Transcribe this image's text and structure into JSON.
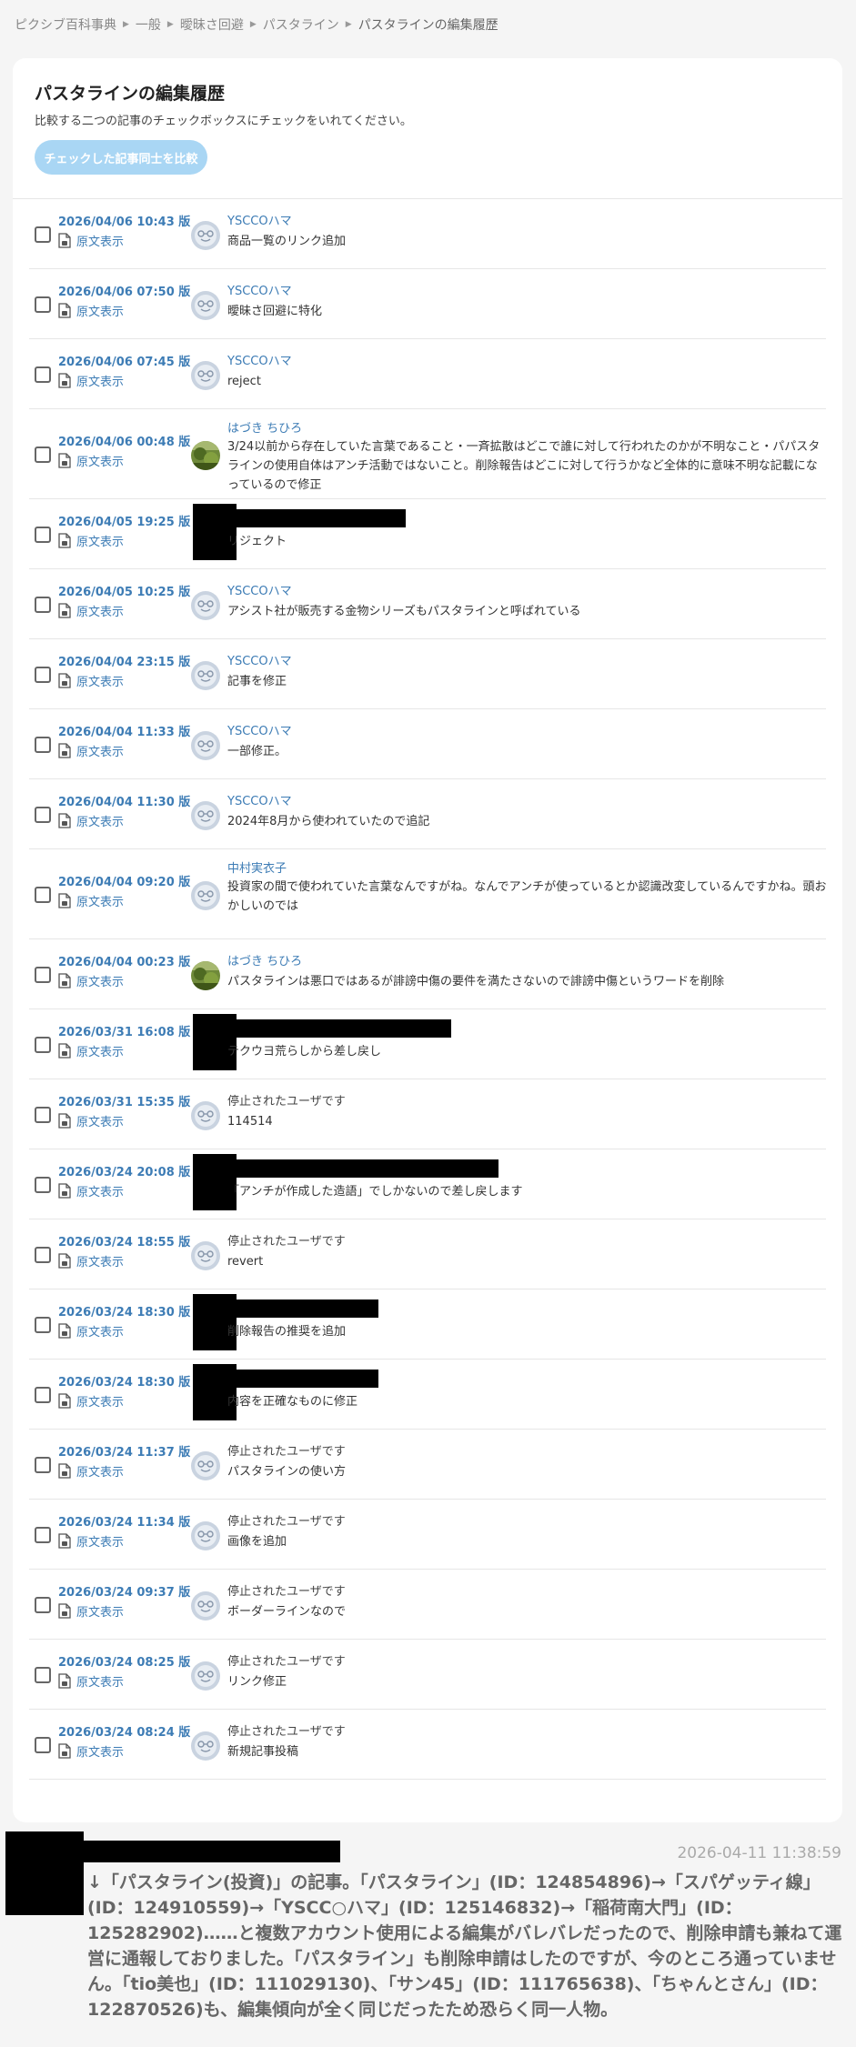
{
  "breadcrumb": {
    "items": [
      "ピクシブ百科事典",
      "一般",
      "曖昧さ回避",
      "パスタライン"
    ],
    "current": "パスタラインの編集履歴"
  },
  "page": {
    "title": "パスタラインの編集履歴",
    "description": "比較する二つの記事のチェックボックスにチェックをいれてください。",
    "compare_button": "チェックした記事同士を比較",
    "source_link_label": "原文表示"
  },
  "colors": {
    "link": "#3d7cb5",
    "button_disabled": "#a9d6f4"
  },
  "revisions": [
    {
      "date": "2026/04/06 10:43 版",
      "user": "YSCCOハマ",
      "user_type": "link",
      "avatar": "default-avatar",
      "comment": "商品一覧のリンク追加"
    },
    {
      "date": "2026/04/06 07:50 版",
      "user": "YSCCOハマ",
      "user_type": "link",
      "avatar": "default-avatar",
      "comment": "曖昧さ回避に特化"
    },
    {
      "date": "2026/04/06 07:45 版",
      "user": "YSCCOハマ",
      "user_type": "link",
      "avatar": "default-avatar",
      "comment": "reject"
    },
    {
      "date": "2026/04/06 00:48 版",
      "user": "はづき ちひろ",
      "user_type": "link",
      "avatar": "photo-avatar",
      "comment": "3/24以前から存在していた言葉であること・一斉拡散はどこで誰に対して行われたのかが不明なこと・パパスタラインの使用自体はアンチ活動ではないこと。削除報告はどこに対して行うかなど全体的に意味不明な記載になっているので修正"
    },
    {
      "date": "2026/04/05 19:25 版",
      "user": "",
      "user_type": "redacted",
      "avatar": "redacted",
      "comment": "リジェクト"
    },
    {
      "date": "2026/04/05 10:25 版",
      "user": "YSCCOハマ",
      "user_type": "link",
      "avatar": "default-avatar",
      "comment": "アシスト社が販売する金物シリーズもパスタラインと呼ばれている"
    },
    {
      "date": "2026/04/04 23:15 版",
      "user": "YSCCOハマ",
      "user_type": "link",
      "avatar": "default-avatar",
      "comment": "記事を修正"
    },
    {
      "date": "2026/04/04 11:33 版",
      "user": "YSCCOハマ",
      "user_type": "link",
      "avatar": "default-avatar",
      "comment": "一部修正。"
    },
    {
      "date": "2026/04/04 11:30 版",
      "user": "YSCCOハマ",
      "user_type": "link",
      "avatar": "default-avatar",
      "comment": "2024年8月から使われていたので追記"
    },
    {
      "date": "2026/04/04 09:20 版",
      "user": "中村実衣子",
      "user_type": "link",
      "avatar": "default-avatar",
      "comment": "投資家の間で使われていた言葉なんですがね。なんでアンチが使っているとか認識改変しているんですかね。頭おかしいのでは"
    },
    {
      "date": "2026/04/04 00:23 版",
      "user": "はづき ちひろ",
      "user_type": "link",
      "avatar": "photo-avatar",
      "comment": "パスタラインは悪口ではあるが誹謗中傷の要件を満たさないので誹謗中傷というワードを削除"
    },
    {
      "date": "2026/03/31 16:08 版",
      "user": "",
      "user_type": "redacted",
      "avatar": "redacted",
      "comment": "テクウヨ荒らしから差し戻し"
    },
    {
      "date": "2026/03/31 15:35 版",
      "user": "停止されたユーザです",
      "user_type": "plain",
      "avatar": "default-avatar",
      "comment": "114514"
    },
    {
      "date": "2026/03/24 20:08 版",
      "user": "",
      "user_type": "redacted",
      "avatar": "redacted",
      "comment": "「アンチが作成した造語」でしかないので差し戻します"
    },
    {
      "date": "2026/03/24 18:55 版",
      "user": "停止されたユーザです",
      "user_type": "plain",
      "avatar": "default-avatar",
      "comment": "revert"
    },
    {
      "date": "2026/03/24 18:30 版",
      "user": "",
      "user_type": "redacted",
      "avatar": "redacted",
      "comment": "削除報告の推奨を追加"
    },
    {
      "date": "2026/03/24 18:30 版",
      "user": "",
      "user_type": "redacted",
      "avatar": "redacted",
      "comment": "内容を正確なものに修正"
    },
    {
      "date": "2026/03/24 11:37 版",
      "user": "停止されたユーザです",
      "user_type": "plain",
      "avatar": "default-avatar",
      "comment": "パスタラインの使い方"
    },
    {
      "date": "2026/03/24 11:34 版",
      "user": "停止されたユーザです",
      "user_type": "plain",
      "avatar": "default-avatar",
      "comment": "画像を追加"
    },
    {
      "date": "2026/03/24 09:37 版",
      "user": "停止されたユーザです",
      "user_type": "plain",
      "avatar": "default-avatar",
      "comment": "ボーダーラインなので"
    },
    {
      "date": "2026/03/24 08:25 版",
      "user": "停止されたユーザです",
      "user_type": "plain",
      "avatar": "default-avatar",
      "comment": "リンク修正"
    },
    {
      "date": "2026/03/24 08:24 版",
      "user": "停止されたユーザです",
      "user_type": "plain",
      "avatar": "default-avatar",
      "comment": "新規記事投稿"
    }
  ],
  "comment": {
    "timestamp": "2026-04-11 11:38:59",
    "body": "↓「パスタライン(投資)」の記事。「パスタライン」(ID：124854896)→「スパゲッティ線」(ID：124910559)→「YSCC○ハマ」(ID：125146832)→「稲荷南大門」(ID：125282902)……と複数アカウント使用による編集がバレバレだったので、削除申請も兼ねて運営に通報しておりました。「パスタライン」も削除申請はしたのですが、今のところ通っていません。「tio美也」(ID：111029130)、「サン45」(ID：111765638)、「ちゃんとさん」(ID：122870526)も、編集傾向が全く同じだったため恐らく同一人物。"
  }
}
